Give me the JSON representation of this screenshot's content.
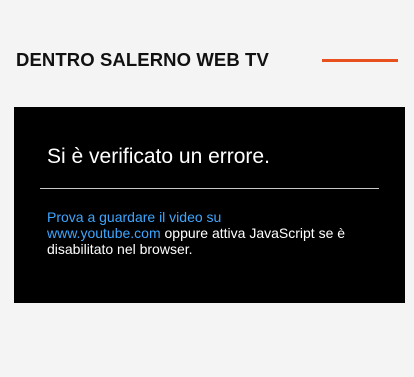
{
  "section": {
    "title": "DENTRO SALERNO WEB TV"
  },
  "video_error": {
    "title": "Si è verificato un errore.",
    "message_link_line1": "Prova a guardare il video su",
    "message_link_line2": "www.youtube.com",
    "message_rest": " oppure attiva JavaScript se è disabilitato nel browser."
  },
  "colors": {
    "page_background": "#f4f4f4",
    "accent": "#e8501e",
    "player_background": "#000000",
    "link": "#3ea6ff",
    "text_on_dark": "#ffffff"
  }
}
